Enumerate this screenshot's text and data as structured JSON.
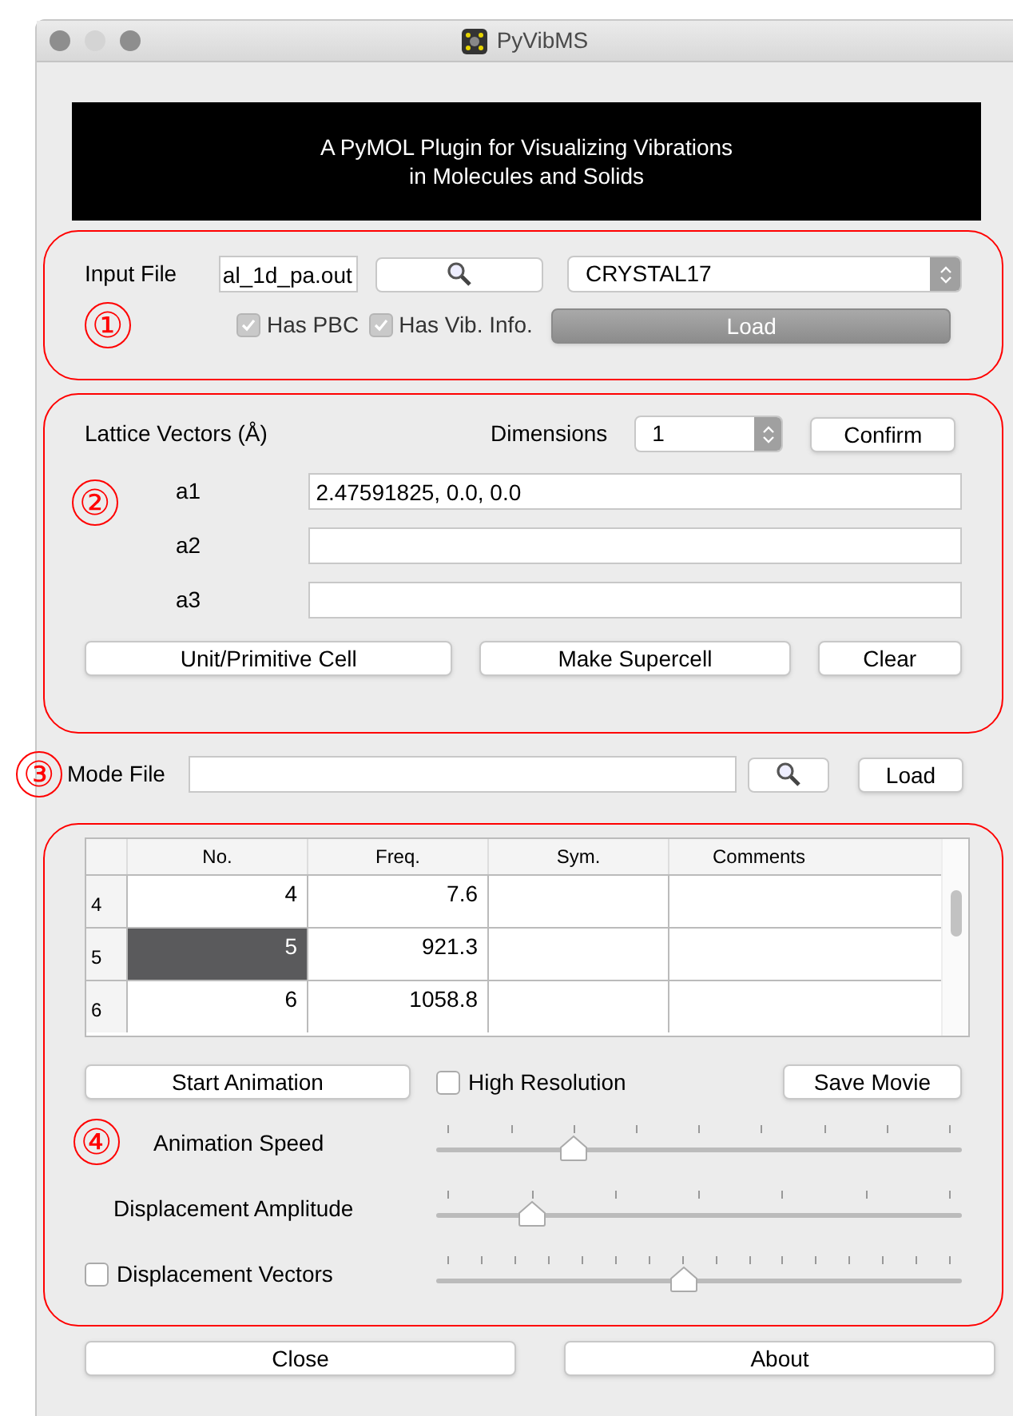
{
  "window": {
    "title": "PyVibMS"
  },
  "banner": {
    "lines": [
      "A PyMOL Plugin for Visualizing Vibrations",
      "in Molecules and Solids"
    ]
  },
  "input_section": {
    "marker": "①",
    "label": "Input File",
    "file_value": "al_1d_pa.out",
    "format": "CRYSTAL17",
    "has_pbc": {
      "label": "Has PBC",
      "checked": true,
      "disabled": true
    },
    "has_vib": {
      "label": "Has Vib. Info.",
      "checked": true,
      "disabled": true
    },
    "load_button": {
      "label": "Load",
      "disabled": true
    }
  },
  "lattice_section": {
    "marker": "②",
    "title": "Lattice Vectors (Å)",
    "dimensions_label": "Dimensions",
    "dimensions_value": "1",
    "confirm": "Confirm",
    "vectors": [
      {
        "label": "a1",
        "value": "2.47591825, 0.0, 0.0"
      },
      {
        "label": "a2"
      },
      {
        "label": "a3"
      }
    ],
    "buttons": [
      "Unit/Primitive Cell",
      "Make Supercell",
      "Clear"
    ]
  },
  "mode_file": {
    "marker": "③",
    "label": "Mode File",
    "load": "Load"
  },
  "modes_section": {
    "marker": "④",
    "table": {
      "columns": [
        "No.",
        "Freq.",
        "Sym.",
        "Comments"
      ],
      "rows": [
        {
          "header": "4",
          "cells": [
            "4",
            "7.6",
            "",
            ""
          ],
          "selected": false
        },
        {
          "header": "5",
          "cells": [
            "5",
            "921.3",
            "",
            ""
          ],
          "selected": true
        },
        {
          "header": "6",
          "cells": [
            "6",
            "1058.8",
            "",
            ""
          ],
          "selected": false
        }
      ]
    },
    "start_animation": "Start Animation",
    "high_resolution": {
      "label": "High Resolution",
      "checked": false
    },
    "save_movie": "Save Movie",
    "sliders": [
      {
        "kind": "label",
        "label": "Animation Speed",
        "level": 0.26
      },
      {
        "kind": "label",
        "label": "Displacement Amplitude",
        "level": 0.18
      },
      {
        "kind": "checkbox",
        "label": "Displacement Vectors",
        "checked": false,
        "level": 0.47
      }
    ]
  },
  "buttons": [
    "Close",
    "About"
  ]
}
